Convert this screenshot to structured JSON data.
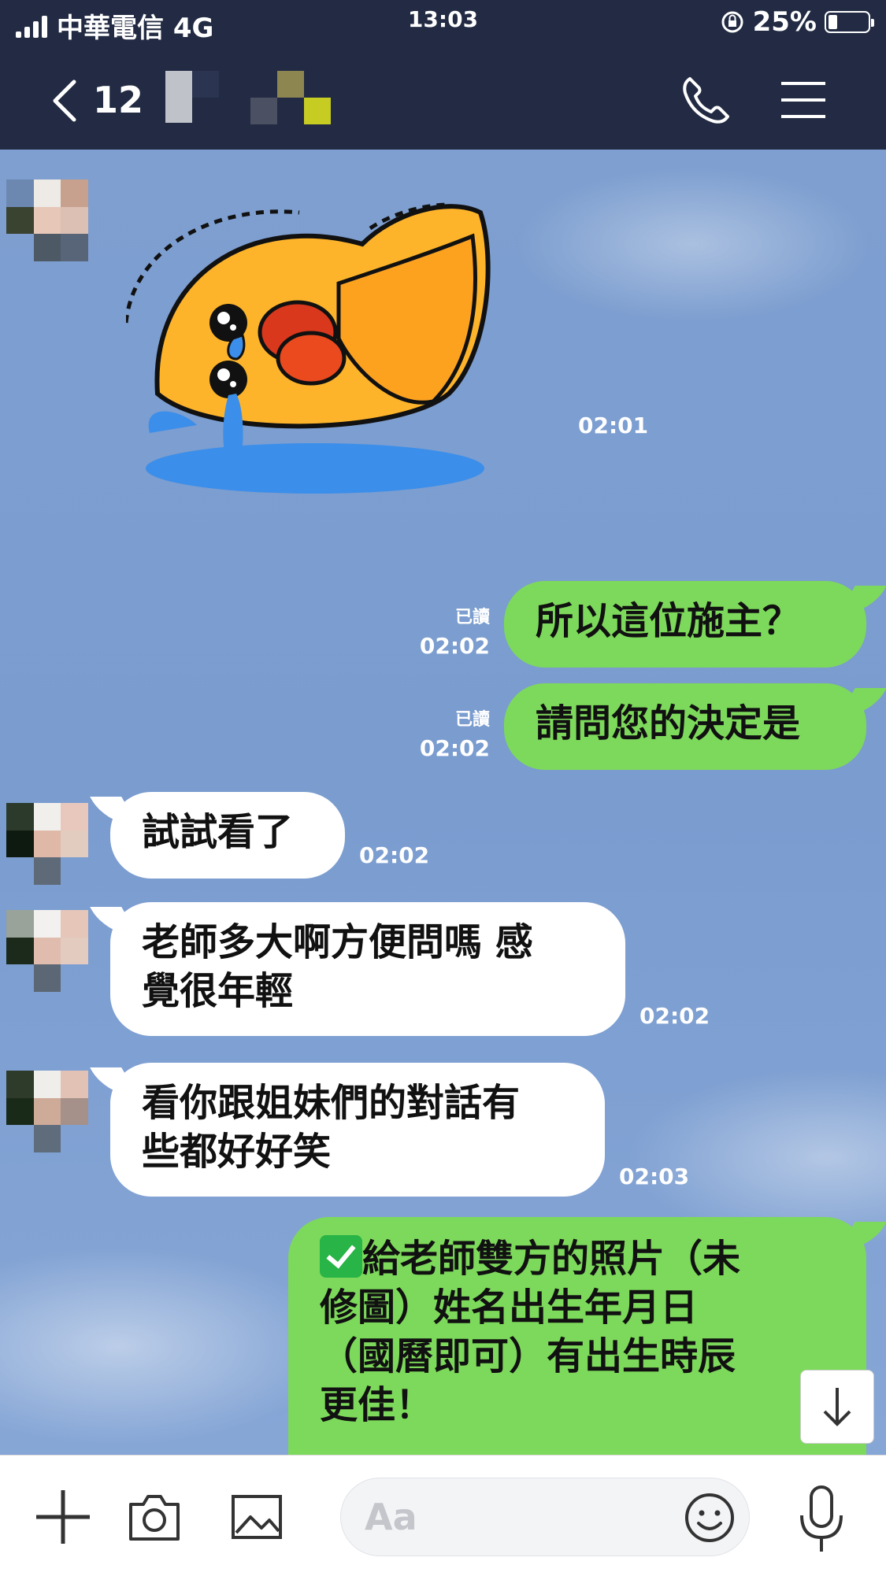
{
  "status_bar": {
    "carrier": "中華電信 4G",
    "time": "13:03",
    "battery": "25%"
  },
  "header": {
    "title": "12",
    "icons": [
      "back-icon",
      "call-icon",
      "menu-icon"
    ]
  },
  "messages": [
    {
      "type": "sticker",
      "direction": "in",
      "time": "02:01"
    },
    {
      "type": "text",
      "direction": "out",
      "text": "所以這位施主？",
      "read": "已讀",
      "time": "02:02"
    },
    {
      "type": "text",
      "direction": "out",
      "text": "請問您的決定是",
      "read": "已讀",
      "time": "02:02"
    },
    {
      "type": "text",
      "direction": "in",
      "text": "試試看了",
      "time": "02:02"
    },
    {
      "type": "text",
      "direction": "in",
      "lines": [
        "老師多大啊方便問嗎 感",
        "覺很年輕"
      ],
      "time": "02:02"
    },
    {
      "type": "text",
      "direction": "in",
      "lines": [
        "看你跟姐妹們的對話有",
        "些都好好笑"
      ],
      "time": "02:03"
    },
    {
      "type": "text",
      "direction": "out",
      "lines": [
        "給老師雙方的照片（未",
        "修圖）姓名出生年月日",
        "（國曆即可）有出生時辰",
        "更佳！"
      ]
    }
  ],
  "input_bar": {
    "placeholder": "Aa",
    "icons": [
      "plus-icon",
      "camera-icon",
      "image-icon",
      "emoji-icon",
      "mic-icon"
    ]
  },
  "colors": {
    "header_bg": "#222b43",
    "outgoing_bubble": "#7dd95b",
    "incoming_bubble": "#ffffff",
    "chat_bg": "#7e9fd0"
  }
}
